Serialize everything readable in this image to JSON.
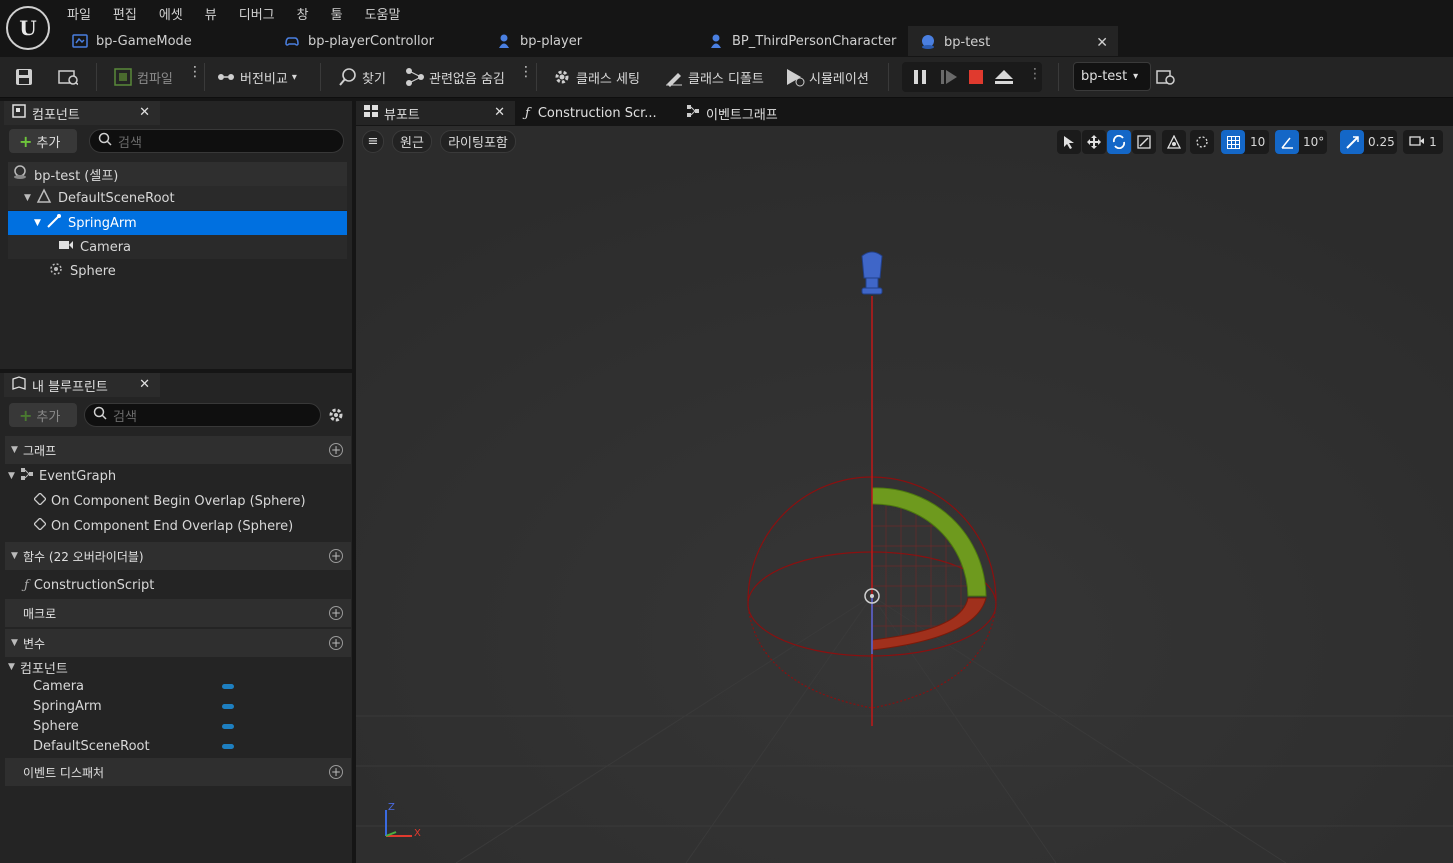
{
  "menu": [
    "파일",
    "편집",
    "에셋",
    "뷰",
    "디버그",
    "창",
    "툴",
    "도움말"
  ],
  "tabs": [
    {
      "label": "bp-GameMode",
      "icon": "gamemode-icon"
    },
    {
      "label": "bp-playerControllor",
      "icon": "controller-icon"
    },
    {
      "label": "bp-player",
      "icon": "pawn-icon"
    },
    {
      "label": "BP_ThirdPersonCharacter",
      "icon": "character-icon"
    },
    {
      "label": "bp-test",
      "icon": "actor-icon",
      "active": true
    }
  ],
  "toolbar": {
    "compile": "컴파일",
    "diff": "버전비교",
    "find": "찾기",
    "hide_unrelated": "관련없음 숨김",
    "class_settings": "클래스 세팅",
    "class_defaults": "클래스 디폴트",
    "simulation": "시뮬레이션",
    "debug_object": "bp-test"
  },
  "components_panel": {
    "title": "컴포넌트",
    "add": "추가",
    "search_placeholder": "검색",
    "items": [
      {
        "label": "bp-test (셀프)"
      },
      {
        "label": "DefaultSceneRoot"
      },
      {
        "label": "SpringArm",
        "selected": true
      },
      {
        "label": "Camera"
      },
      {
        "label": "Sphere"
      }
    ]
  },
  "my_blueprint": {
    "title": "내 블루프린트",
    "add": "추가",
    "search_placeholder": "검색",
    "sections": {
      "graph": "그래프",
      "functions": "함수 (22 오버라이더블)",
      "macros": "매크로",
      "variables": "변수",
      "dispatchers": "이벤트 디스패처"
    },
    "graph_items": [
      "EventGraph",
      "On Component Begin Overlap (Sphere)",
      "On Component End Overlap (Sphere)"
    ],
    "function_items": [
      "ConstructionScript"
    ],
    "variable_category": "컴포넌트",
    "variables": [
      "Camera",
      "SpringArm",
      "Sphere",
      "DefaultSceneRoot"
    ]
  },
  "editor_tabs": [
    "뷰포트",
    "Construction Scr...",
    "이벤트그래프"
  ],
  "viewport": {
    "perspective": "원근",
    "lit": "라이팅포함",
    "grid_snap": "10",
    "rot_snap": "10°",
    "scale_snap": "0.25",
    "camera_speed": "1",
    "axis_z": "Z",
    "axis_x": "X"
  },
  "colors": {
    "selection": "#0070e0",
    "accent_green": "#6ec63b",
    "stop_red": "#e03a2e"
  }
}
